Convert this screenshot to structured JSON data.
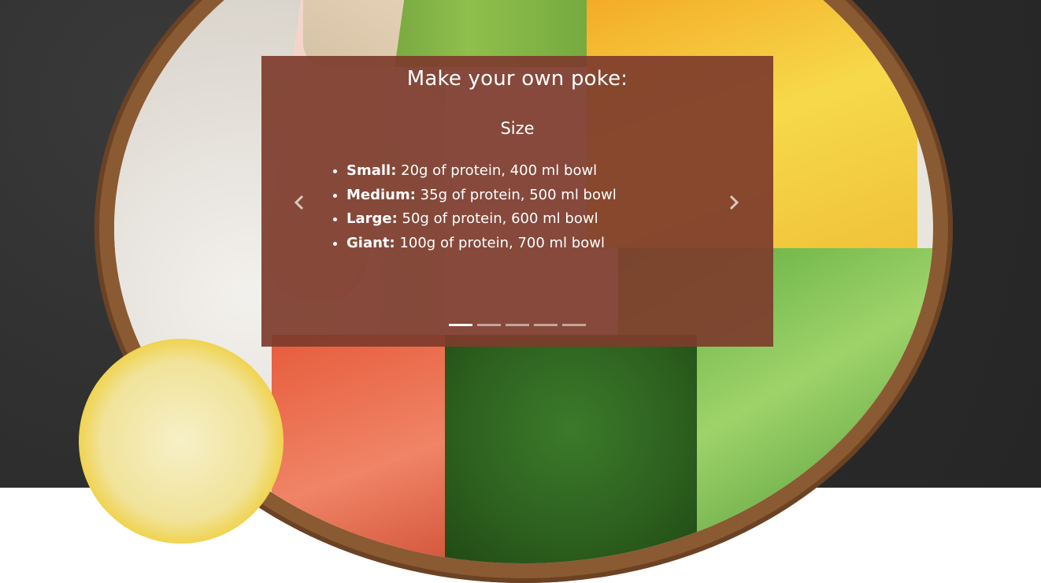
{
  "carousel": {
    "title": "Make your own poke:",
    "slide": {
      "heading": "Size",
      "items": [
        {
          "label": "Small:",
          "text": " 20g of protein, 400 ml bowl"
        },
        {
          "label": "Medium:",
          "text": " 35g of protein, 500 ml bowl"
        },
        {
          "label": "Large:",
          "text": " 50g of protein, 600 ml bowl"
        },
        {
          "label": "Giant:",
          "text": " 100g of protein, 700 ml bowl"
        }
      ]
    },
    "indicator_count": 5,
    "active_indicator": 1,
    "prev_icon": "chevron-left-icon",
    "next_icon": "chevron-right-icon",
    "overlay_color": "#7d3c2d"
  }
}
